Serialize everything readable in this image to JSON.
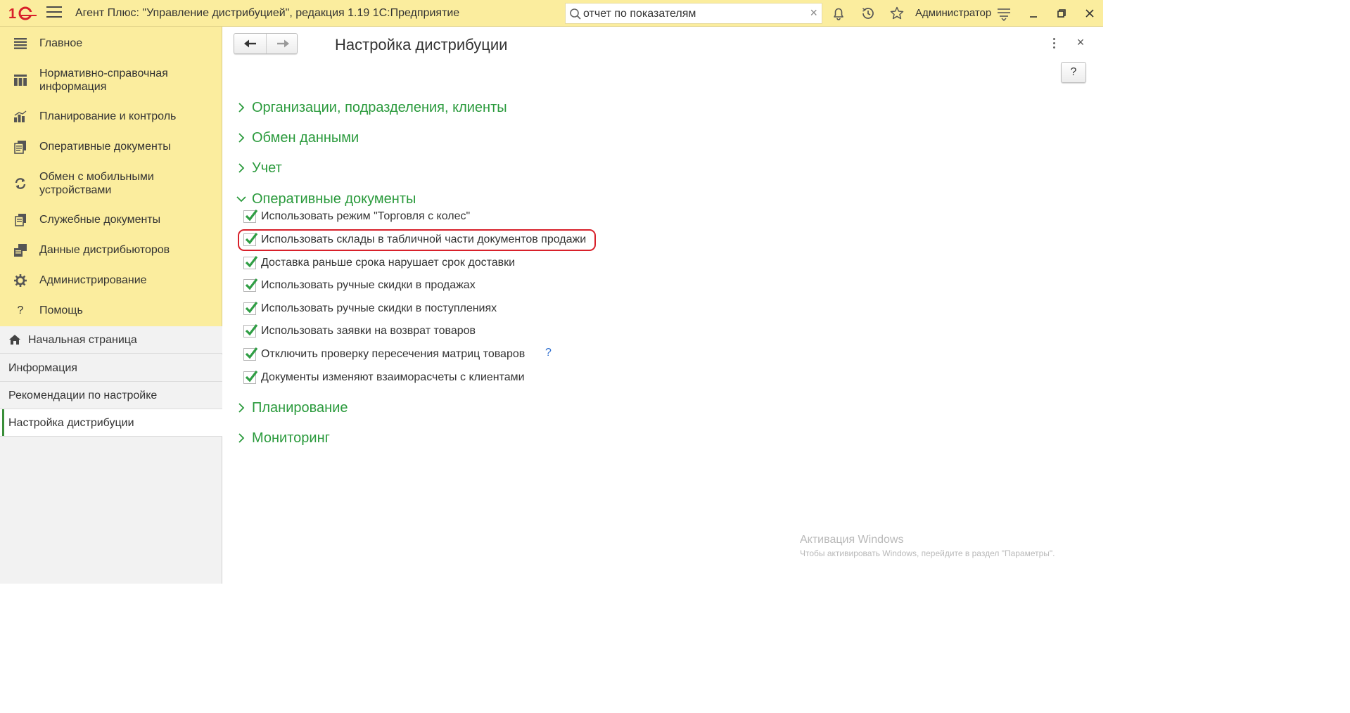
{
  "titlebar": {
    "app_title": "Агент Плюс: \"Управление дистрибуцией\", редакция 1.19 1С:Предприятие",
    "search_value": "отчет по показателям",
    "user": "Администратор"
  },
  "sidebar": {
    "items": [
      {
        "label": "Главное",
        "icon": "menu-lines-icon"
      },
      {
        "label": "Нормативно-справочная информация",
        "icon": "grid-icon"
      },
      {
        "label": "Планирование и контроль",
        "icon": "bar-chart-icon"
      },
      {
        "label": "Оперативные документы",
        "icon": "documents-icon"
      },
      {
        "label": "Обмен с мобильными устройствами",
        "icon": "sync-icon"
      },
      {
        "label": "Служебные документы",
        "icon": "service-documents-icon"
      },
      {
        "label": "Данные дистрибьюторов",
        "icon": "distributor-data-icon"
      },
      {
        "label": "Администрирование",
        "icon": "gear-icon"
      },
      {
        "label": "Помощь",
        "icon": "question-icon"
      }
    ]
  },
  "open_windows": [
    {
      "label": "Начальная страница",
      "icon": "home-icon"
    },
    {
      "label": "Информация"
    },
    {
      "label": "Рекомендации по настройке"
    },
    {
      "label": "Настройка дистрибуции",
      "active": true
    }
  ],
  "main": {
    "title": "Настройка дистрибуции",
    "help_label": "?",
    "sections": [
      {
        "label": "Организации, подразделения, клиенты",
        "expanded": false
      },
      {
        "label": "Обмен данными",
        "expanded": false
      },
      {
        "label": "Учет",
        "expanded": false
      },
      {
        "label": "Оперативные документы",
        "expanded": true
      },
      {
        "label": "Планирование",
        "expanded": false
      },
      {
        "label": "Мониторинг",
        "expanded": false
      }
    ],
    "checkboxes": [
      {
        "label": "Использовать режим \"Торговля с колес\"",
        "checked": true
      },
      {
        "label": "Использовать склады в табличной части документов продажи",
        "checked": true,
        "highlighted": true
      },
      {
        "label": "Доставка раньше срока нарушает срок доставки",
        "checked": true
      },
      {
        "label": "Использовать ручные скидки в продажах",
        "checked": true
      },
      {
        "label": "Использовать ручные скидки в поступлениях",
        "checked": true
      },
      {
        "label": "Использовать заявки на возврат товаров",
        "checked": true
      },
      {
        "label": "Отключить проверку пересечения матриц товаров",
        "checked": true,
        "help": "?"
      },
      {
        "label": "Документы изменяют взаиморасчеты с клиентами",
        "checked": true
      }
    ]
  },
  "watermark": {
    "line1": "Активация Windows",
    "line2": "Чтобы активировать Windows, перейдите в раздел \"Параметры\"."
  },
  "colors": {
    "titlebar_bg": "#fbed9e",
    "section_green": "#2a9a3c",
    "checkmark_green": "#2f9e44",
    "highlight_red": "#d8202a"
  }
}
